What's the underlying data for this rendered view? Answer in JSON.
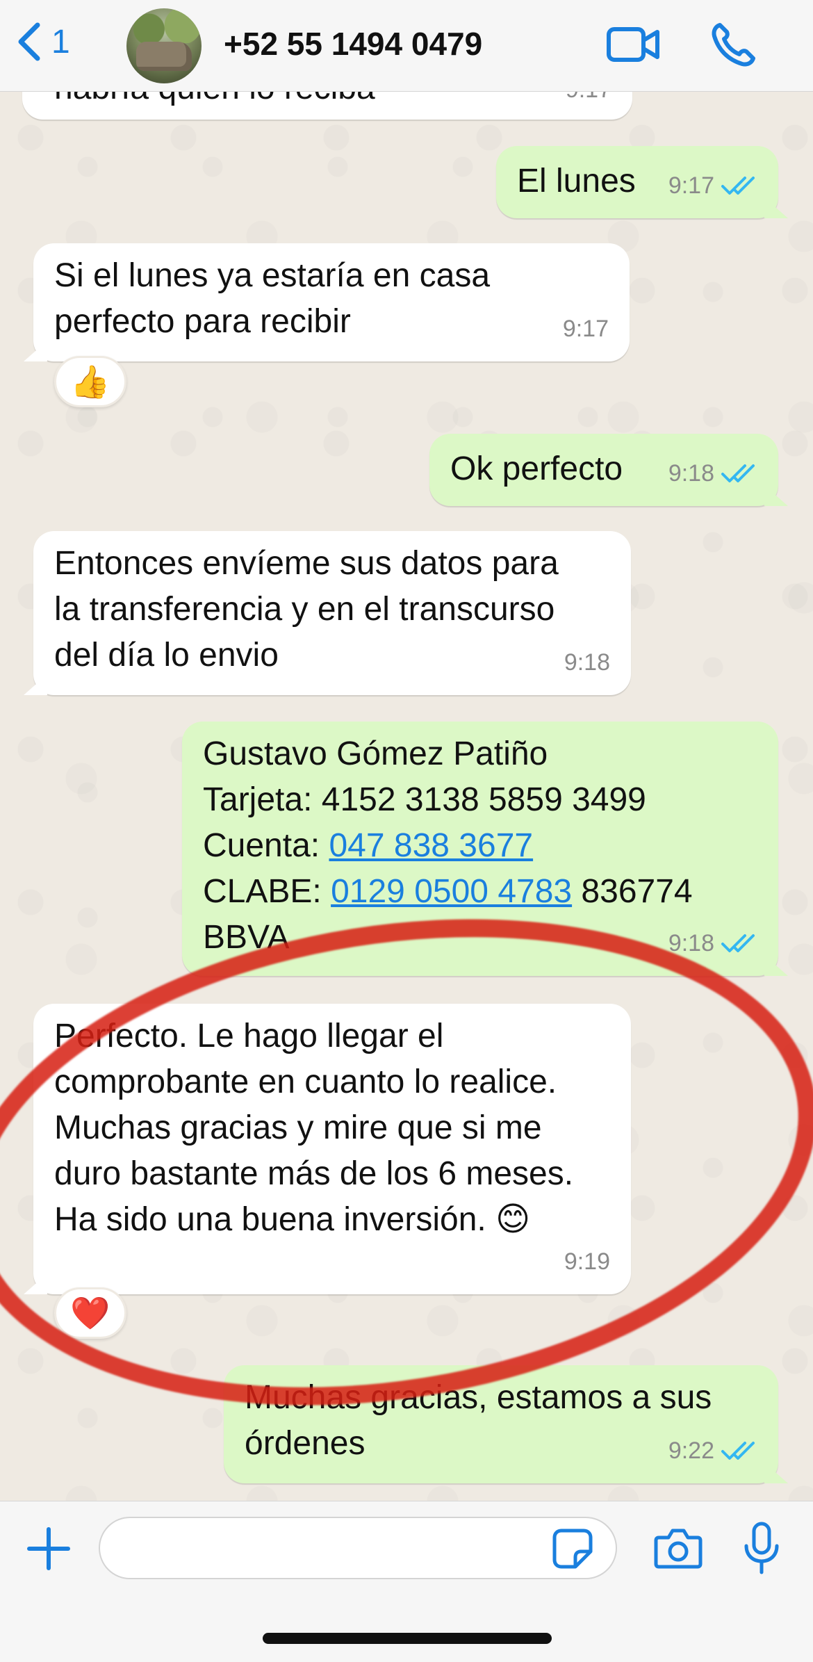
{
  "header": {
    "back_count": "1",
    "contact_name": "+52 55 1494 0479",
    "accent_color": "#1a7fde"
  },
  "messages": [
    {
      "direction": "in",
      "text": "habría quien lo reciba",
      "time": "9:17"
    },
    {
      "direction": "out",
      "text": "El lunes",
      "time": "9:17",
      "status_icon": "double-check-icon"
    },
    {
      "direction": "in",
      "text": "Si el lunes ya estaría en casa\nperfecto para recibir",
      "time": "9:17",
      "reaction": "👍"
    },
    {
      "direction": "out",
      "text": "Ok perfecto",
      "time": "9:18",
      "status_icon": "double-check-icon"
    },
    {
      "direction": "in",
      "text": "Entonces envíeme sus datos para\nla transferencia y en el transcurso\ndel día lo envio",
      "time": "9:18"
    },
    {
      "direction": "out",
      "time": "9:18",
      "status_icon": "double-check-icon",
      "lines": {
        "name": "Gustavo Gómez Patiño",
        "card": "Tarjeta: 4152 3138 5859 3499",
        "account_label": "Cuenta: ",
        "account_link": "047 838 3677",
        "clabe_label": "CLABE: ",
        "clabe_link": "0129 0500 4783",
        "clabe_rest": " 836774",
        "bank": "BBVA"
      }
    },
    {
      "direction": "in",
      "text": "Perfecto. Le hago llegar el\ncomprobante en cuanto lo realice.\nMuchas gracias  y mire que si me\nduro bastante más de los 6 meses.\nHa sido una buena inversión. 😊",
      "time": "9:19",
      "reaction": "❤️"
    },
    {
      "direction": "out",
      "text": "Muchas gracias, estamos a sus\nórdenes",
      "time": "9:22",
      "status_icon": "double-check-icon"
    }
  ],
  "composer": {
    "value": "",
    "placeholder": ""
  },
  "colors": {
    "incoming_bubble": "#ffffff",
    "outgoing_bubble": "#dcf8c6",
    "annotation_circle": "#d61e12",
    "read_ticks": "#34b7f1"
  }
}
